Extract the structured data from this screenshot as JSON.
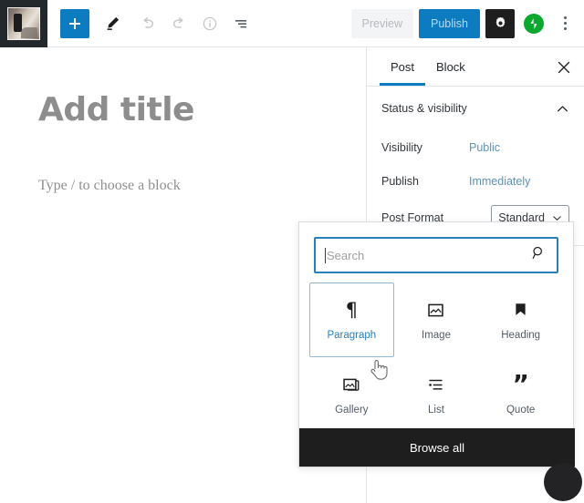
{
  "toolbar": {
    "site_icon_name": "site-thumbnail",
    "add_block_label": "+",
    "edit_tool_label": "Edit",
    "undo_label": "Undo",
    "redo_label": "Redo",
    "details_label": "Details",
    "list_view_label": "List view",
    "preview_label": "Preview",
    "publish_label": "Publish",
    "settings_label": "Settings",
    "jetpack_label": "Jetpack",
    "more_label": "Options"
  },
  "editor": {
    "title_placeholder": "Add title",
    "block_placeholder": "Type / to choose a block",
    "inline_inserter_label": "+"
  },
  "sidebar": {
    "tabs": [
      {
        "label": "Post",
        "active": true
      },
      {
        "label": "Block",
        "active": false
      }
    ],
    "close_label": "×",
    "panel": {
      "title": "Status & visibility",
      "rows": [
        {
          "label": "Visibility",
          "value": "Public",
          "type": "link"
        },
        {
          "label": "Publish",
          "value": "Immediately",
          "type": "link"
        },
        {
          "label": "Post Format",
          "value": "Standard",
          "type": "select"
        }
      ]
    }
  },
  "inserter": {
    "search_placeholder": "Search",
    "search_value": "",
    "blocks": [
      {
        "label": "Paragraph",
        "icon": "pilcrow-icon",
        "hovered": true
      },
      {
        "label": "Image",
        "icon": "image-icon",
        "hovered": false
      },
      {
        "label": "Heading",
        "icon": "heading-bookmark-icon",
        "hovered": false
      },
      {
        "label": "Gallery",
        "icon": "gallery-icon",
        "hovered": false
      },
      {
        "label": "List",
        "icon": "list-icon",
        "hovered": false
      },
      {
        "label": "Quote",
        "icon": "quote-icon",
        "hovered": false
      }
    ],
    "browse_all_label": "Browse all"
  },
  "colors": {
    "accent_blue": "#0c7bc0",
    "focus_blue": "#2a7fba",
    "link_blue": "#5d93b8",
    "dark": "#1e1e1e",
    "jetpack_green": "#0aa82e",
    "border": "#e2e4e7"
  }
}
